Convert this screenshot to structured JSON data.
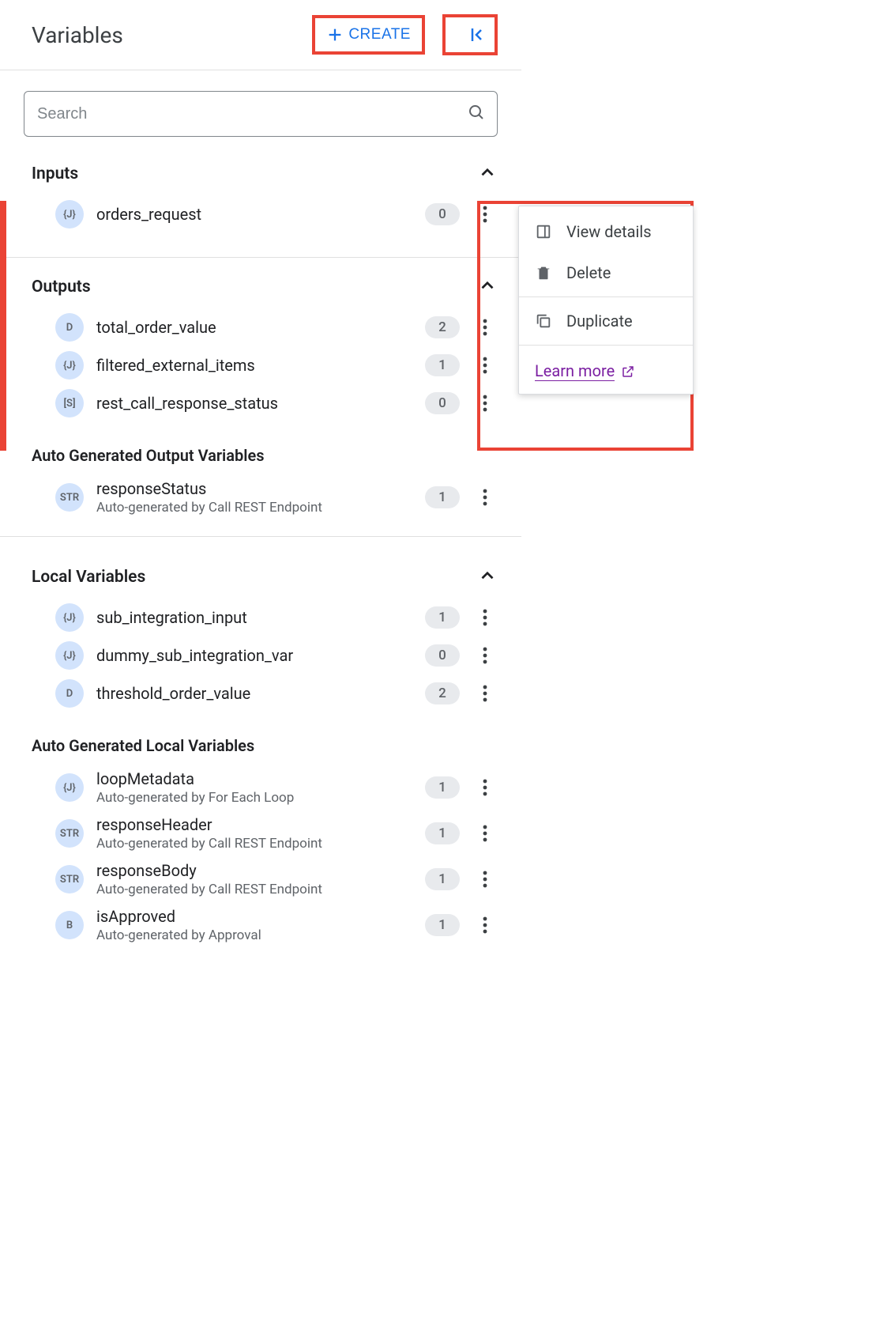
{
  "header": {
    "title": "Variables",
    "create_label": "CREATE"
  },
  "search": {
    "placeholder": "Search"
  },
  "sections": {
    "inputs": {
      "title": "Inputs",
      "items": [
        {
          "type_badge": "{J}",
          "name": "orders_request",
          "count": "0"
        }
      ]
    },
    "outputs": {
      "title": "Outputs",
      "items": [
        {
          "type_badge": "D",
          "name": "total_order_value",
          "count": "2"
        },
        {
          "type_badge": "{J}",
          "name": "filtered_external_items",
          "count": "1"
        },
        {
          "type_badge": "[S]",
          "name": "rest_call_response_status",
          "count": "0"
        }
      ]
    },
    "auto_outputs": {
      "title": "Auto Generated Output Variables",
      "items": [
        {
          "type_badge": "STR",
          "name": "responseStatus",
          "sub": "Auto-generated by Call REST Endpoint",
          "count": "1"
        }
      ]
    },
    "locals": {
      "title": "Local Variables",
      "items": [
        {
          "type_badge": "{J}",
          "name": "sub_integration_input",
          "count": "1"
        },
        {
          "type_badge": "{J}",
          "name": "dummy_sub_integration_var",
          "count": "0"
        },
        {
          "type_badge": "D",
          "name": "threshold_order_value",
          "count": "2"
        }
      ]
    },
    "auto_locals": {
      "title": "Auto Generated Local Variables",
      "items": [
        {
          "type_badge": "{J}",
          "name": "loopMetadata",
          "sub": "Auto-generated by For Each Loop",
          "count": "1"
        },
        {
          "type_badge": "STR",
          "name": "responseHeader",
          "sub": "Auto-generated by Call REST Endpoint",
          "count": "1"
        },
        {
          "type_badge": "STR",
          "name": "responseBody",
          "sub": "Auto-generated by Call REST Endpoint",
          "count": "1"
        },
        {
          "type_badge": "B",
          "name": "isApproved",
          "sub": "Auto-generated by Approval",
          "count": "1"
        }
      ]
    }
  },
  "menu": {
    "view_details": "View details",
    "delete": "Delete",
    "duplicate": "Duplicate",
    "learn_more": "Learn more"
  }
}
